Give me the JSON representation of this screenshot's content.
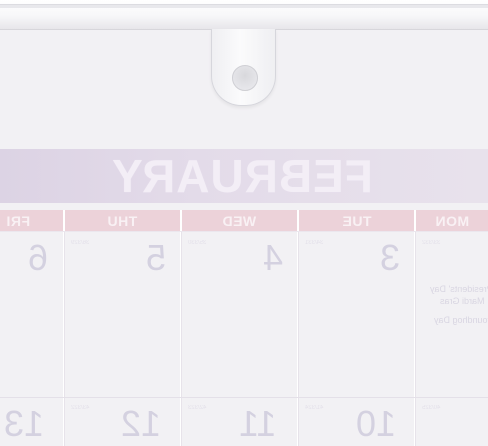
{
  "calendar": {
    "month": "FEBRUARY",
    "days": [
      {
        "key": "mon",
        "label": "MON"
      },
      {
        "key": "tue",
        "label": "TUE"
      },
      {
        "key": "wed",
        "label": "WED"
      },
      {
        "key": "thu",
        "label": "THU"
      },
      {
        "key": "fri",
        "label": "FRI"
      }
    ],
    "week1": {
      "mon": "",
      "tue": "3",
      "wed": "4",
      "thu": "5",
      "fri": "6"
    },
    "week2": {
      "mon": "",
      "tue": "10",
      "wed": "11",
      "thu": "12",
      "fri": "13"
    },
    "small_labels": {
      "tue1": "34/331",
      "wed1": "35/330",
      "thu1": "36/329",
      "mon1": "33/332",
      "mon2": "40/325",
      "tue2": "41/324",
      "wed2": "42/323",
      "thu2": "43/322",
      "fri2": "44/321"
    },
    "holidays": {
      "line1": "Presidents' Day",
      "line2": "Mardi Gras",
      "line3": "Groundhog Day"
    }
  },
  "colors": {
    "month_band": "#dcd3e4",
    "day_header": "#ecd2d9",
    "numbers": "#d4d1e0"
  }
}
